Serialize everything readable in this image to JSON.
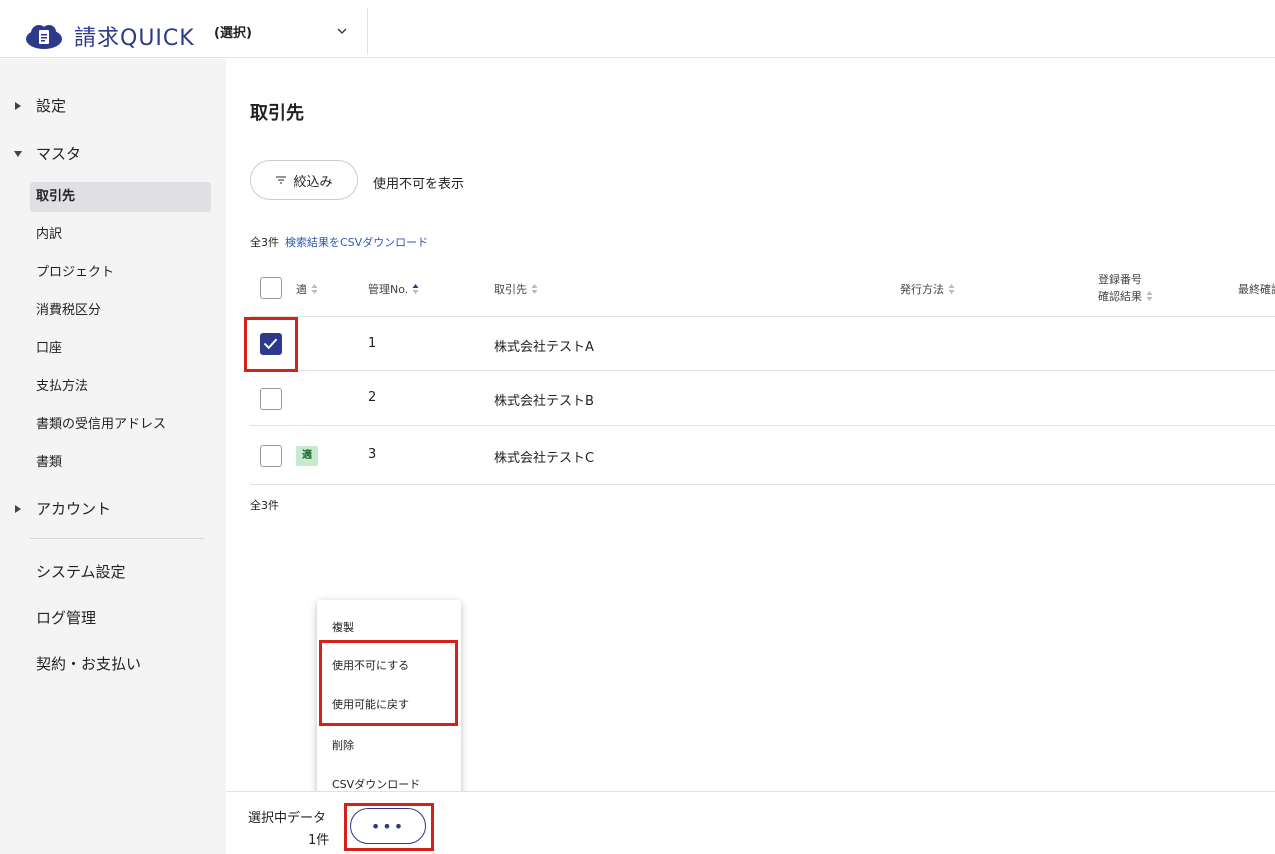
{
  "app": {
    "brand": "請求QUICK",
    "org_select": "(選択)"
  },
  "sidebar": {
    "settings": "設定",
    "master": "マスタ",
    "items": [
      "取引先",
      "内訳",
      "プロジェクト",
      "消費税区分",
      "口座",
      "支払方法",
      "書類の受信用アドレス",
      "書類"
    ],
    "account": "アカウント",
    "system_settings": "システム設定",
    "log_mgmt": "ログ管理",
    "contract": "契約・お支払い"
  },
  "main": {
    "title": "取引先",
    "filter_label": "絞込み",
    "show_disabled": "使用不可を表示",
    "count": "全3件",
    "csv_link": "検索結果をCSVダウンロード",
    "footer_count": "全3件"
  },
  "table": {
    "headers": {
      "badge": "適",
      "no": "管理No.",
      "client": "取引先",
      "method": "発行方法",
      "reg1": "登録番号",
      "reg2": "確認結果",
      "last": "最終確認"
    },
    "rows": [
      {
        "no": "1",
        "client": "株式会社テストA",
        "checked": true,
        "badge": ""
      },
      {
        "no": "2",
        "client": "株式会社テストB",
        "checked": false,
        "badge": ""
      },
      {
        "no": "3",
        "client": "株式会社テストC",
        "checked": false,
        "badge": "適"
      }
    ]
  },
  "menu": {
    "items": [
      "複製",
      "使用不可にする",
      "使用可能に戻す",
      "削除",
      "CSVダウンロード"
    ]
  },
  "bottom": {
    "selected_label": "選択中データ",
    "selected_count": "1件",
    "more": "•••"
  },
  "colors": {
    "brand": "#2d3a8c",
    "highlight": "#d4211a",
    "badge_bg": "#c7ebcf"
  }
}
